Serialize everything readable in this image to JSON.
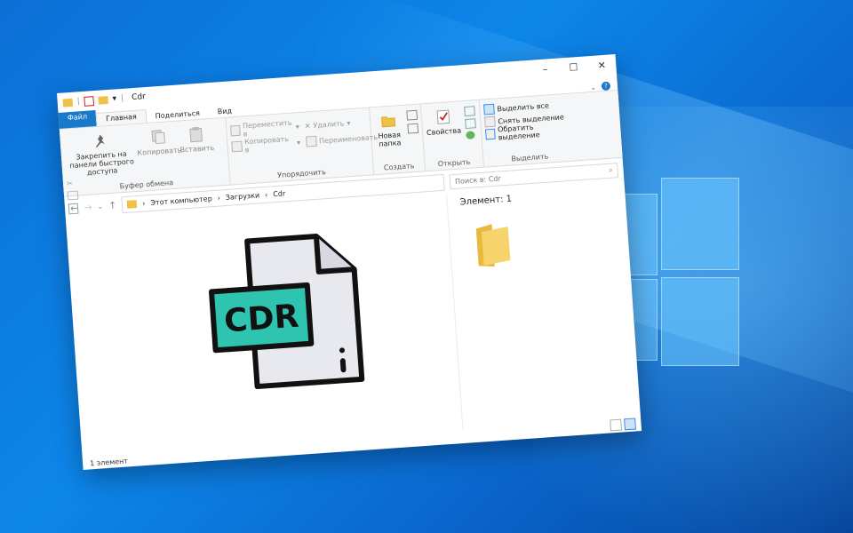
{
  "window": {
    "title": "Cdr"
  },
  "ribbon_tabs": [
    "Файл",
    "Главная",
    "Поделиться",
    "Вид"
  ],
  "clipboard": {
    "pin_label": "Закрепить на панели быстрого доступа",
    "copy_label": "Копировать",
    "paste_label": "Вставить",
    "group_label": "Буфер обмена"
  },
  "organize": {
    "move_label": "Переместить в",
    "copy_to_label": "Копировать в",
    "delete_label": "Удалить",
    "rename_label": "Переименовать",
    "group_label": "Упорядочить"
  },
  "create": {
    "new_folder_label": "Новая папка",
    "group_label": "Создать"
  },
  "open": {
    "properties_label": "Свойства",
    "group_label": "Открыть"
  },
  "select": {
    "select_all_label": "Выделить все",
    "select_none_label": "Снять выделение",
    "invert_label": "Обратить выделение",
    "group_label": "Выделить"
  },
  "breadcrumb": [
    "Этот компьютер",
    "Загрузки",
    "Cdr"
  ],
  "search": {
    "placeholder": "Поиск в: Cdr"
  },
  "file_icon": {
    "label": "CDR",
    "accent": "#2ec4b0"
  },
  "preview": {
    "count": "Элемент: 1"
  },
  "status": {
    "text": "1 элемент"
  }
}
